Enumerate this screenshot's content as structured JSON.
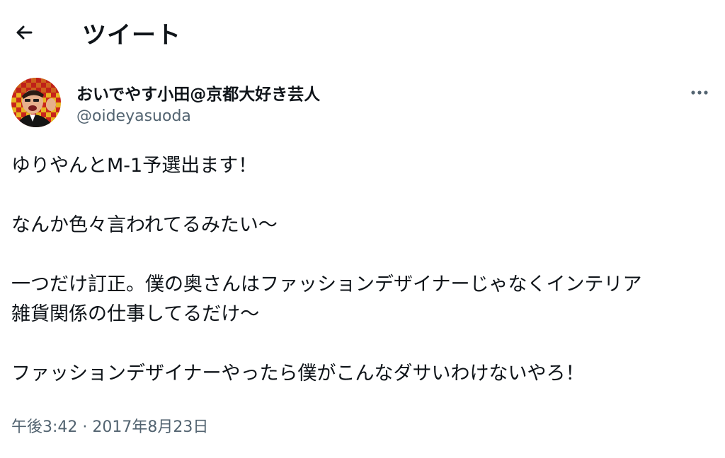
{
  "header": {
    "title": "ツイート",
    "back_icon": "arrow-left-icon"
  },
  "author": {
    "display_name": "おいでやす小田@京都大好き芸人",
    "handle": "@oideyasuoda",
    "avatar_icon": "avatar-image"
  },
  "more_icon": "more-horizontal-icon",
  "tweet": {
    "paragraphs": [
      [
        "ゆりやんとM-1予選出ます！"
      ],
      [
        "なんか色々言われてるみたい〜"
      ],
      [
        "一つだけ訂正。僕の奥さんはファッションデザイナーじゃなくインテリア",
        "雑貨関係の仕事してるだけ〜"
      ],
      [
        "ファッションデザイナーやったら僕がこんなダサいわけないやろ！"
      ]
    ],
    "timestamp": "午後3:42 · 2017年8月23日"
  },
  "colors": {
    "text_primary": "#0f1419",
    "text_secondary": "#536471",
    "background": "#ffffff"
  }
}
